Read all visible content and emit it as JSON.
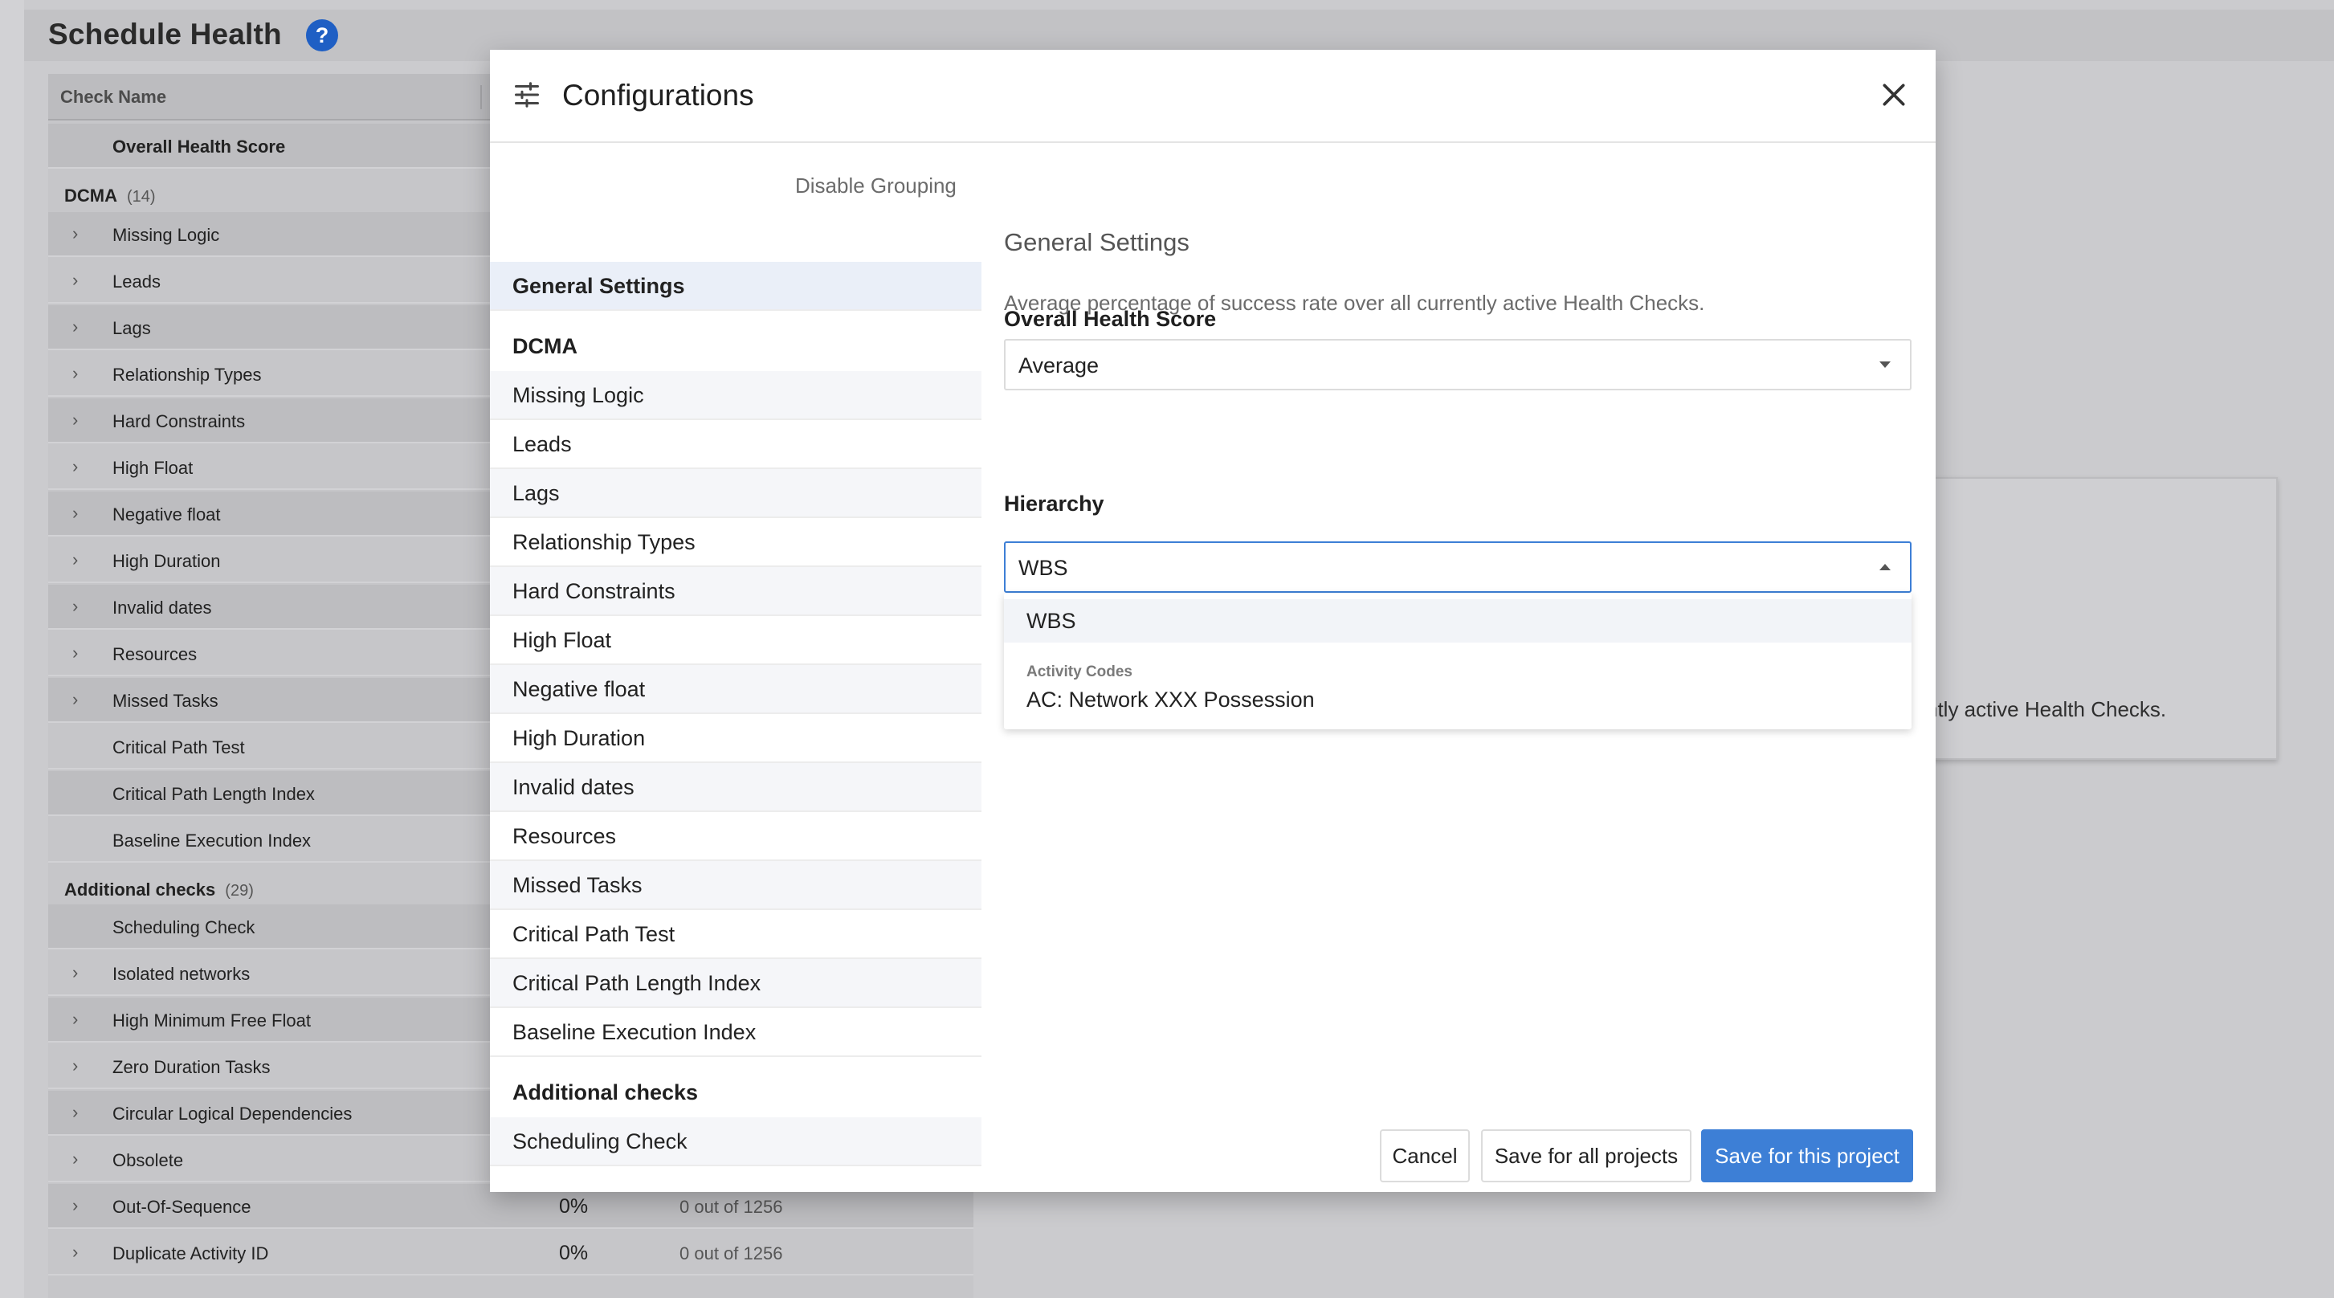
{
  "page": {
    "title": "Schedule Health",
    "help_icon": "question-mark-icon"
  },
  "table": {
    "header": "Check Name",
    "overall_row": "Overall Health Score",
    "groups": [
      {
        "name": "DCMA",
        "count": "(14)"
      },
      {
        "name": "Additional checks",
        "count": "(29)"
      }
    ],
    "dcma_rows": [
      "Missing Logic",
      "Leads",
      "Lags",
      "Relationship Types",
      "Hard Constraints",
      "High Float",
      "Negative float",
      "High Duration",
      "Invalid dates",
      "Resources",
      "Missed Tasks",
      "Critical Path Test",
      "Critical Path Length Index",
      "Baseline Execution Index"
    ],
    "additional_rows": [
      "Scheduling Check",
      "Isolated networks",
      "High Minimum Free Float",
      "Zero Duration Tasks",
      "Circular Logical Dependencies",
      "Obsolete",
      "Out-Of-Sequence",
      "Duplicate Activity ID"
    ],
    "out_of_sequence": {
      "pct": "0%",
      "count": "0 out of 1256"
    },
    "duplicate_activity": {
      "pct": "0%",
      "count": "0 out of 1256"
    }
  },
  "background_card": {
    "text": "ntly active Health Checks."
  },
  "modal": {
    "title": "Configurations",
    "icon": "sliders-icon",
    "close_icon": "close-icon",
    "disable_grouping": "Disable Grouping",
    "nav": {
      "general": "General Settings",
      "dcma_group": "DCMA",
      "dcma_items": [
        "Missing Logic",
        "Leads",
        "Lags",
        "Relationship Types",
        "Hard Constraints",
        "High Float",
        "Negative float",
        "High Duration",
        "Invalid dates",
        "Resources",
        "Missed Tasks",
        "Critical Path Test",
        "Critical Path Length Index",
        "Baseline Execution Index"
      ],
      "additional_group": "Additional checks",
      "additional_items": [
        "Scheduling Check"
      ]
    },
    "content": {
      "section_title": "General Settings",
      "overall_label": "Overall Health Score",
      "overall_desc": "Average percentage of success rate over all currently active Health Checks.",
      "overall_value": "Average",
      "hierarchy_label": "Hierarchy",
      "hierarchy_value": "WBS",
      "dropdown": {
        "option_1": "WBS",
        "group_label": "Activity Codes",
        "option_2": "AC: Network XXX Possession"
      }
    },
    "buttons": {
      "cancel": "Cancel",
      "save_all": "Save for all projects",
      "save_this": "Save for this project"
    },
    "accent_color": "#3d7fd6"
  }
}
